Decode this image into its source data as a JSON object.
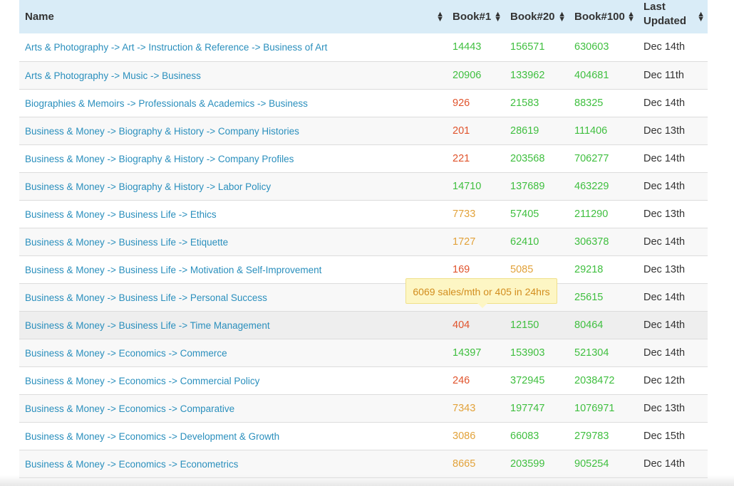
{
  "table": {
    "headers": {
      "name": "Name",
      "book1": "Book#1",
      "book20": "Book#20",
      "book100": "Book#100",
      "updated": "Last Updated"
    },
    "rows": [
      {
        "name": "Arts & Photography -> Art -> Instruction & Reference -> Business of Art",
        "book1": "14443",
        "book20": "156571",
        "book100": "630603",
        "updated": "Dec 14th"
      },
      {
        "name": "Arts & Photography -> Music -> Business",
        "book1": "20906",
        "book20": "133962",
        "book100": "404681",
        "updated": "Dec 11th"
      },
      {
        "name": "Biographies & Memoirs -> Professionals & Academics -> Business",
        "book1": "926",
        "book20": "21583",
        "book100": "88325",
        "updated": "Dec 14th"
      },
      {
        "name": "Business & Money -> Biography & History -> Company Histories",
        "book1": "201",
        "book20": "28619",
        "book100": "111406",
        "updated": "Dec 13th"
      },
      {
        "name": "Business & Money -> Biography & History -> Company Profiles",
        "book1": "221",
        "book20": "203568",
        "book100": "706277",
        "updated": "Dec 14th"
      },
      {
        "name": "Business & Money -> Biography & History -> Labor Policy",
        "book1": "14710",
        "book20": "137689",
        "book100": "463229",
        "updated": "Dec 14th"
      },
      {
        "name": "Business & Money -> Business Life -> Ethics",
        "book1": "7733",
        "book20": "57405",
        "book100": "211290",
        "updated": "Dec 13th"
      },
      {
        "name": "Business & Money -> Business Life -> Etiquette",
        "book1": "1727",
        "book20": "62410",
        "book100": "306378",
        "updated": "Dec 14th"
      },
      {
        "name": "Business & Money -> Business Life -> Motivation & Self-Improvement",
        "book1": "169",
        "book20": "5085",
        "book100": "29218",
        "updated": "Dec 13th"
      },
      {
        "name": "Business & Money -> Business Life -> Personal Success",
        "book1": "",
        "book20": "",
        "book100": "25615",
        "updated": "Dec 14th"
      },
      {
        "name": "Business & Money -> Business Life -> Time Management",
        "book1": "404",
        "book20": "12150",
        "book100": "80464",
        "updated": "Dec 14th"
      },
      {
        "name": "Business & Money -> Economics -> Commerce",
        "book1": "14397",
        "book20": "153903",
        "book100": "521304",
        "updated": "Dec 14th"
      },
      {
        "name": "Business & Money -> Economics -> Commercial Policy",
        "book1": "246",
        "book20": "372945",
        "book100": "2038472",
        "updated": "Dec 12th"
      },
      {
        "name": "Business & Money -> Economics -> Comparative",
        "book1": "7343",
        "book20": "197747",
        "book100": "1076971",
        "updated": "Dec 13th"
      },
      {
        "name": "Business & Money -> Economics -> Development & Growth",
        "book1": "3086",
        "book20": "66083",
        "book100": "279783",
        "updated": "Dec 15th"
      },
      {
        "name": "Business & Money -> Economics -> Econometrics",
        "book1": "8665",
        "book20": "203599",
        "book100": "905254",
        "updated": "Dec 14th"
      }
    ]
  },
  "tooltip": {
    "text": "6069 sales/mth or 405 in 24hrs"
  },
  "colors": {
    "green": "#3fbf3f",
    "orange": "#e2a23a",
    "red": "#e0532c",
    "link": "#2a8fbd",
    "header_bg": "#d9ecf7"
  },
  "icons": {
    "sort": "sort-icon"
  }
}
